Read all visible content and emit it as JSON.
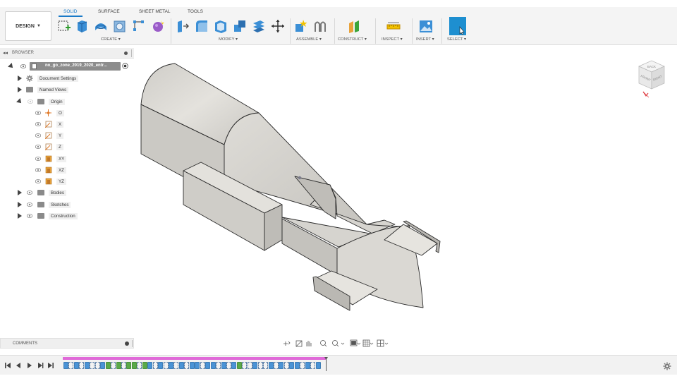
{
  "toolbar": {
    "workspace": "DESIGN",
    "tabs": [
      {
        "label": "SOLID",
        "active": true
      },
      {
        "label": "SURFACE",
        "active": false
      },
      {
        "label": "SHEET METAL",
        "active": false
      },
      {
        "label": "TOOLS",
        "active": false
      }
    ],
    "groups": {
      "create": "CREATE ▾",
      "modify": "MODIFY ▾",
      "assemble": "ASSEMBLE ▾",
      "construct": "CONSTRUCT ▾",
      "inspect": "INSPECT ▾",
      "insert": "INSERT ▾",
      "select": "SELECT ▾"
    }
  },
  "browser": {
    "title": "BROWSER",
    "items": [
      {
        "label": "no_go_zone_2019_2020_entr...",
        "icon": "document-icon"
      },
      {
        "label": "Document Settings",
        "icon": "gear-icon"
      },
      {
        "label": "Named Views",
        "icon": "folder-icon"
      },
      {
        "label": "Origin",
        "icon": "folder-icon"
      },
      {
        "label": "O",
        "icon": "origin-point-icon"
      },
      {
        "label": "X",
        "icon": "axis-icon"
      },
      {
        "label": "Y",
        "icon": "axis-icon"
      },
      {
        "label": "Z",
        "icon": "axis-icon"
      },
      {
        "label": "XY",
        "icon": "plane-icon"
      },
      {
        "label": "XZ",
        "icon": "plane-icon"
      },
      {
        "label": "YZ",
        "icon": "plane-icon"
      },
      {
        "label": "Bodies",
        "icon": "folder-icon"
      },
      {
        "label": "Sketches",
        "icon": "folder-icon"
      },
      {
        "label": "Construction",
        "icon": "folder-icon"
      }
    ]
  },
  "comments": {
    "title": "COMMENTS"
  },
  "viewcube": {
    "labels": [
      "BACK",
      "RIGHT",
      "FRONT"
    ]
  },
  "colors": {
    "accent": "#1a7ac8",
    "timeline_track": "#e06ad8",
    "model_body": "#dcdad5",
    "model_edge": "#2a2a2a"
  }
}
